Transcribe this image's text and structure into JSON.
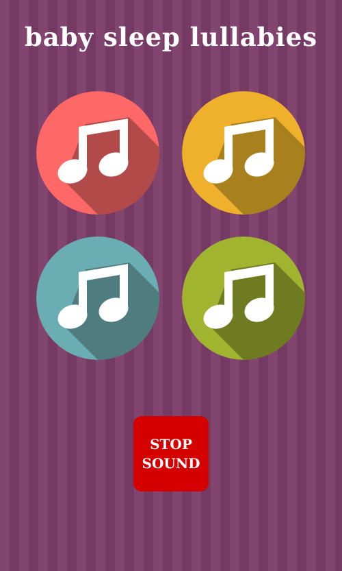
{
  "app": {
    "title": "baby sleep lullabies"
  },
  "tracks": [
    {
      "icon": "music-note-icon",
      "color": "#fe6866",
      "shadow": "#b14a48"
    },
    {
      "icon": "music-note-icon",
      "color": "#efb12b",
      "shadow": "#a8801e"
    },
    {
      "icon": "music-note-icon",
      "color": "#6aaeb3",
      "shadow": "#4f7c7f"
    },
    {
      "icon": "music-note-icon",
      "color": "#a1b42f",
      "shadow": "#6e7b20"
    }
  ],
  "stop_button": {
    "label": "STOP\nSOUND",
    "color": "#d50000"
  },
  "colors": {
    "background": "#7b3f6a",
    "stripe_light": "#824570",
    "stripe_dark": "#753a64"
  }
}
